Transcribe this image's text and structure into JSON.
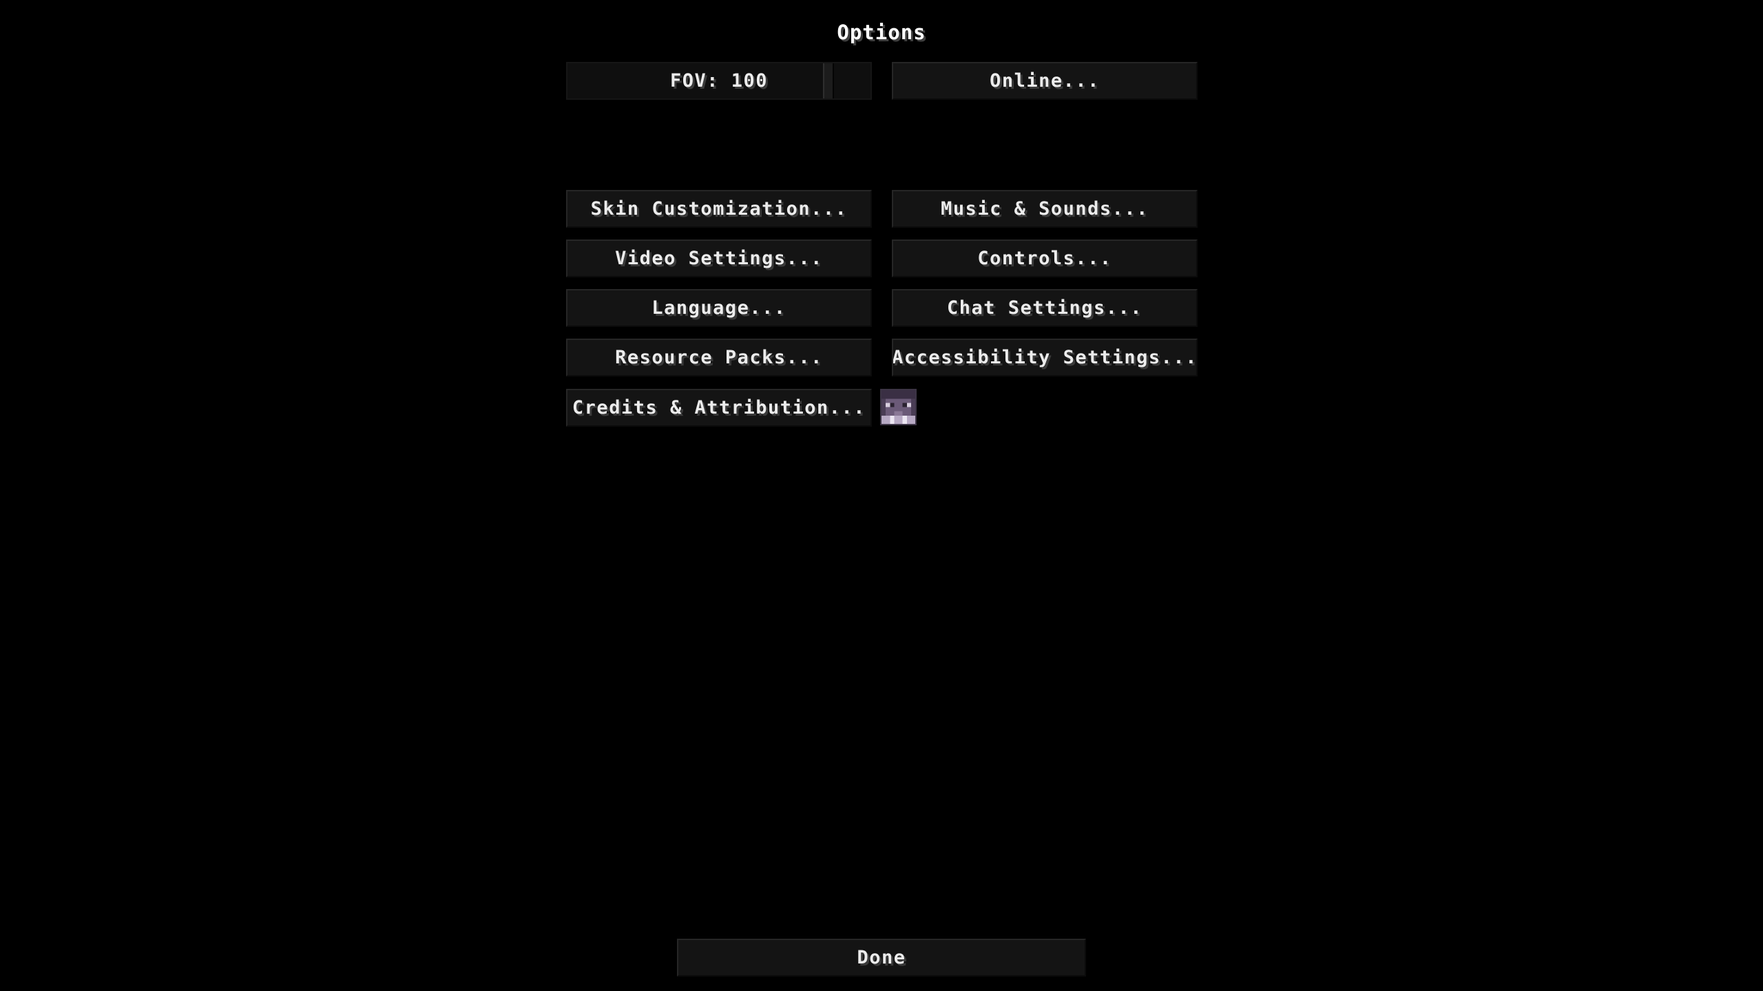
{
  "screen": {
    "title": "Options"
  },
  "fov": {
    "label": "FOV: 100",
    "value": 100,
    "range": [
      30,
      110
    ]
  },
  "buttons": {
    "online": "Online...",
    "skin_customization": "Skin Customization...",
    "music_sounds": "Music & Sounds...",
    "video_settings": "Video Settings...",
    "controls": "Controls...",
    "language": "Language...",
    "chat_settings": "Chat Settings...",
    "resource_packs": "Resource Packs...",
    "accessibility_settings": "Accessibility Settings...",
    "credits_attribution": "Credits & Attribution...",
    "done": "Done"
  },
  "icons": {
    "player_head": "player-head-icon"
  },
  "colors": {
    "background": "#000000",
    "button_fill": "#141414",
    "text": "#ececec",
    "text_shadow": "#3a3a3a"
  }
}
